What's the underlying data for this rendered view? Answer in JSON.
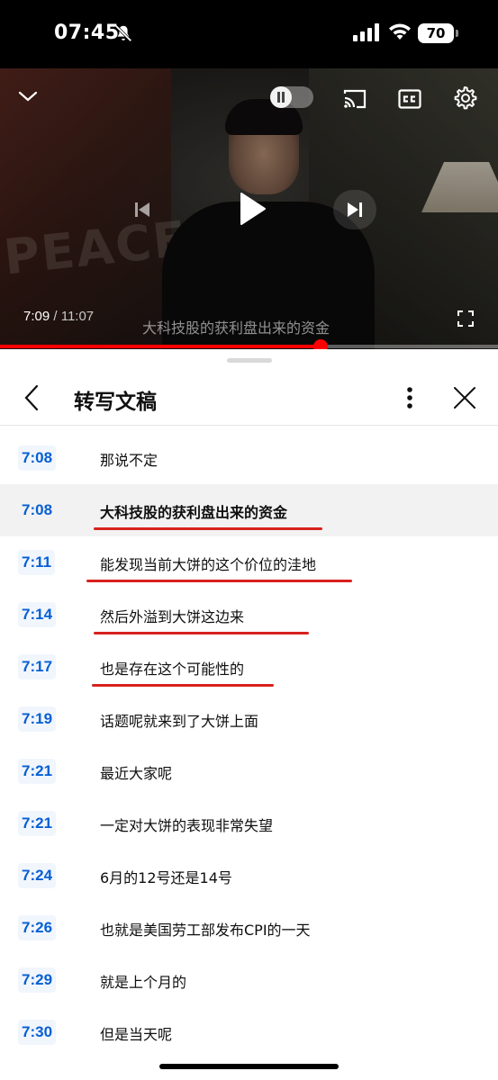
{
  "status_bar": {
    "time": "07:45",
    "battery": "70"
  },
  "video": {
    "current_time": "7:09",
    "separator": " / ",
    "total_time": "11:07",
    "subtitle": "大科技股的获利盘出来的资金",
    "watermark": "PEACE",
    "progress_fraction": 0.644
  },
  "transcript": {
    "title": "转写文稿",
    "segments": [
      {
        "time": "7:08",
        "text": "那说不定"
      },
      {
        "time": "7:08",
        "text": "大科技股的获利盘出来的资金"
      },
      {
        "time": "7:11",
        "text": "能发现当前大饼的这个价位的洼地"
      },
      {
        "time": "7:14",
        "text": "然后外溢到大饼这边来"
      },
      {
        "time": "7:17",
        "text": "也是存在这个可能性的"
      },
      {
        "time": "7:19",
        "text": "话题呢就来到了大饼上面"
      },
      {
        "time": "7:21",
        "text": "最近大家呢"
      },
      {
        "time": "7:21",
        "text": "一定对大饼的表现非常失望"
      },
      {
        "time": "7:24",
        "text": "6月的12号还是14号"
      },
      {
        "time": "7:26",
        "text": "也就是美国劳工部发布CPI的一天"
      },
      {
        "time": "7:29",
        "text": "就是上个月的"
      },
      {
        "time": "7:30",
        "text": "但是当天呢"
      }
    ]
  },
  "colors": {
    "accent_red": "#ff0000",
    "timestamp_blue": "#065fd4",
    "annotation_red": "#d8211e"
  }
}
